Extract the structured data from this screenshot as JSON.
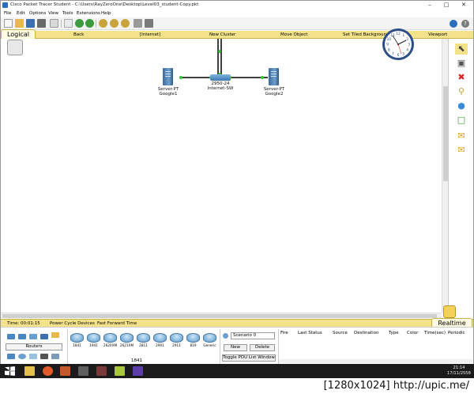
{
  "window": {
    "title": "Cisco Packet Tracer Student - C:\\Users\\RayZeroOne\\Desktop\\Level03_student-Copy.pkt",
    "controls": [
      "–",
      "□",
      "✕"
    ]
  },
  "menu": [
    "File",
    "Edit",
    "Options",
    "View",
    "Tools",
    "Extensions",
    "Help"
  ],
  "logical_bar": {
    "tab": "Logical",
    "items": [
      "Back",
      "[Internet]",
      "New Cluster",
      "Move Object",
      "Set Tiled Background",
      "Viewport"
    ]
  },
  "devices": [
    {
      "id": "google1",
      "type": "Server-PT",
      "name": "Google1"
    },
    {
      "id": "internet-sw",
      "type": "2950-24",
      "name": "Internet-SW"
    },
    {
      "id": "google2",
      "type": "Server-PT",
      "name": "Google2"
    }
  ],
  "link_color": "#2fc62f",
  "clock": {
    "numbers": [
      "12",
      "1",
      "2",
      "3",
      "4",
      "5",
      "6",
      "7",
      "8",
      "9",
      "10",
      "11"
    ]
  },
  "status_bar": {
    "time_label": "Time: 00:01:15",
    "power_cycle": "Power Cycle Devices",
    "fast_forward": "Fast Forward Time",
    "mode": "Realtime"
  },
  "device_categories": {
    "selected": "Routers"
  },
  "router_models": [
    "1841",
    "1941",
    "2620XM",
    "2621XM",
    "2811",
    "2901",
    "2911",
    "819",
    "Generic"
  ],
  "selected_model": "1841",
  "scenario": {
    "select_value": "Scenario 0",
    "new_label": "New",
    "delete_label": "Delete",
    "toggle_label": "Toggle PDU List Window"
  },
  "pdu_columns": [
    "Fire",
    "Last Status",
    "Source",
    "Destination",
    "Type",
    "Color",
    "Time(sec)",
    "Periodic"
  ],
  "taskbar": {
    "time": "21:14",
    "date": "17/11/2558"
  },
  "watermark": "[1280x1024] http://upic.me/"
}
